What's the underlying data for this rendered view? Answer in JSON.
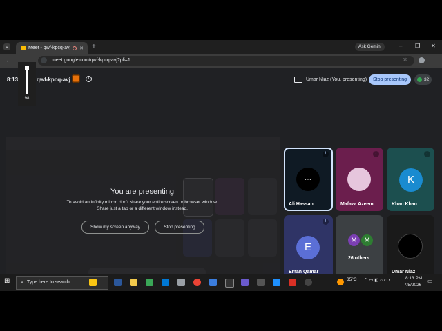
{
  "browser": {
    "tab_title": "Meet - qwf-kpcq-avj",
    "new_tab": "+",
    "ask_gemini": "Ask Gemini",
    "url": "meet.google.com/qwf-kpcq-avj?pli=1",
    "minimize": "–",
    "restore": "❐",
    "close": "✕"
  },
  "meet": {
    "time": "8:13",
    "meeting_code": "qwf-kpcq-avj",
    "presenter_label": "Umar Niaz (You, presenting)",
    "stop_presenting_top": "Stop presenting",
    "participant_count": "32"
  },
  "volume": {
    "level": 98,
    "label": "98"
  },
  "presenting_notice": {
    "heading": "You are presenting",
    "line1": "To avoid an infinity mirror, don't share your entire screen or browser window.",
    "line2": "Share just a tab or a different window instead.",
    "show_anyway": "Show my screen anyway",
    "stop": "Stop presenting"
  },
  "tiles": [
    {
      "name": "Ali Hassan",
      "muted": true
    },
    {
      "name": "Mafaza Azeem",
      "muted": true
    },
    {
      "name": "Khan Khan",
      "initial": "K",
      "muted": true
    },
    {
      "name": "Eman Qamar",
      "initial": "E",
      "muted": true
    },
    {
      "name": "26 others",
      "initials": [
        "M",
        "M"
      ]
    },
    {
      "name": "Umar Niaz"
    }
  ],
  "taskbar": {
    "search_placeholder": "Type here to search",
    "temperature": "35°C",
    "time": "8:13 PM",
    "date": "7/5/2026"
  },
  "colors": {
    "accent": "#a8c7fa",
    "end_call": "#d93025",
    "tile_bg": "#3c4043",
    "khan_avatar": "#1a8bd0",
    "eman_avatar": "#5b6fd6"
  }
}
